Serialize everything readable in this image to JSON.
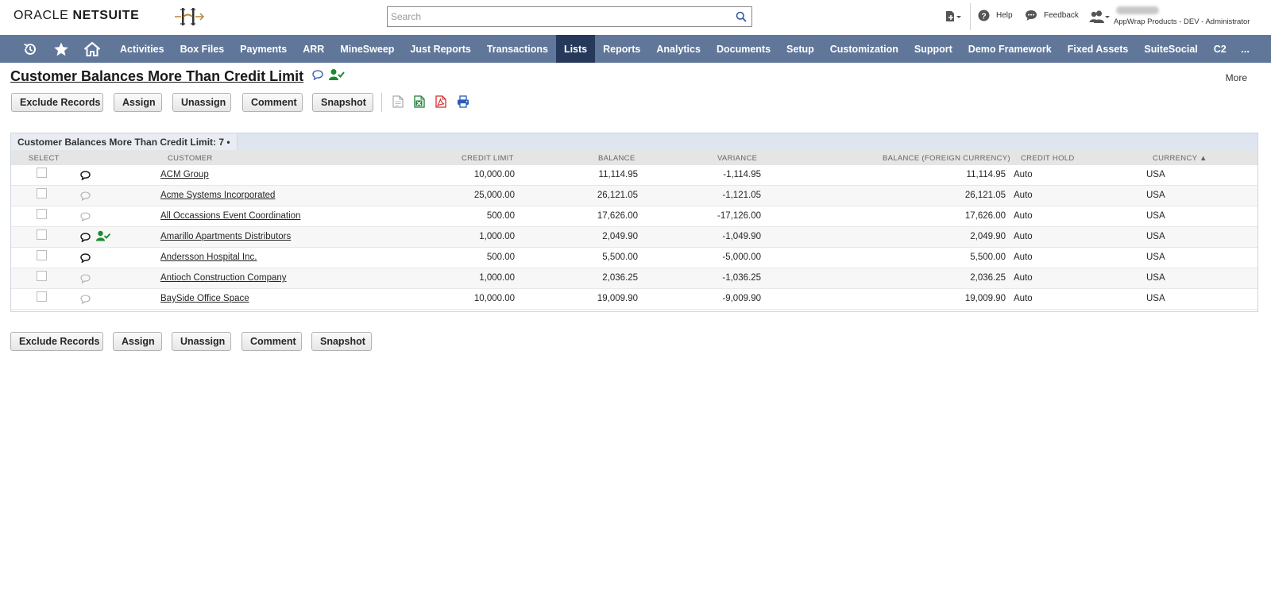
{
  "header": {
    "brand_oracle": "ORACLE",
    "brand_netsuite": "NETSUITE",
    "search_placeholder": "Search",
    "help_label": "Help",
    "feedback_label": "Feedback",
    "user_role": "AppWrap Products - DEV - Administrator"
  },
  "nav": {
    "items": [
      "Activities",
      "Box Files",
      "Payments",
      "ARR",
      "MineSweep",
      "Just Reports",
      "Transactions",
      "Lists",
      "Reports",
      "Analytics",
      "Documents",
      "Setup",
      "Customization",
      "Support",
      "Demo Framework",
      "Fixed Assets",
      "SuiteSocial",
      "C2"
    ],
    "active": "Lists",
    "more": "..."
  },
  "page": {
    "title": "Customer Balances More Than Credit Limit",
    "more_label": "More"
  },
  "toolbar": {
    "exclude": "Exclude Records",
    "assign": "Assign",
    "unassign": "Unassign",
    "comment": "Comment",
    "snapshot": "Snapshot"
  },
  "list": {
    "title": "Customer Balances More Than Credit Limit: 7 •",
    "columns": {
      "select": "SELECT",
      "customer": "CUSTOMER",
      "credit_limit": "CREDIT LIMIT",
      "balance": "BALANCE",
      "variance": "VARIANCE",
      "balance_fc": "BALANCE (FOREIGN CURRENCY)",
      "credit_hold": "CREDIT HOLD",
      "currency": "CURRENCY ▲"
    },
    "rows": [
      {
        "customer": "ACM Group",
        "credit_limit": "10,000.00",
        "balance": "11,114.95",
        "variance": "-1,114.95",
        "balance_fc": "11,114.95",
        "credit_hold": "Auto",
        "currency": "USA",
        "comment": "dark",
        "assigned": false
      },
      {
        "customer": "Acme Systems Incorporated",
        "credit_limit": "25,000.00",
        "balance": "26,121.05",
        "variance": "-1,121.05",
        "balance_fc": "26,121.05",
        "credit_hold": "Auto",
        "currency": "USA",
        "comment": "light",
        "assigned": false
      },
      {
        "customer": "All Occassions Event Coordination",
        "credit_limit": "500.00",
        "balance": "17,626.00",
        "variance": "-17,126.00",
        "balance_fc": "17,626.00",
        "credit_hold": "Auto",
        "currency": "USA",
        "comment": "light",
        "assigned": false
      },
      {
        "customer": "Amarillo Apartments Distributors",
        "credit_limit": "1,000.00",
        "balance": "2,049.90",
        "variance": "-1,049.90",
        "balance_fc": "2,049.90",
        "credit_hold": "Auto",
        "currency": "USA",
        "comment": "dark",
        "assigned": true
      },
      {
        "customer": "Andersson Hospital Inc.",
        "credit_limit": "500.00",
        "balance": "5,500.00",
        "variance": "-5,000.00",
        "balance_fc": "5,500.00",
        "credit_hold": "Auto",
        "currency": "USA",
        "comment": "dark",
        "assigned": false
      },
      {
        "customer": "Antioch Construction Company",
        "credit_limit": "1,000.00",
        "balance": "2,036.25",
        "variance": "-1,036.25",
        "balance_fc": "2,036.25",
        "credit_hold": "Auto",
        "currency": "USA",
        "comment": "light",
        "assigned": false
      },
      {
        "customer": "BaySide Office Space",
        "credit_limit": "10,000.00",
        "balance": "19,009.90",
        "variance": "-9,009.90",
        "balance_fc": "19,009.90",
        "credit_hold": "Auto",
        "currency": "USA",
        "comment": "light",
        "assigned": false
      }
    ]
  },
  "icons": {
    "nav": [
      "recent-records-icon",
      "star-icon",
      "home-icon"
    ],
    "export": [
      "csv-icon",
      "excel-icon",
      "pdf-icon",
      "print-icon"
    ]
  },
  "colors": {
    "nav_bg": "#607799",
    "nav_active": "#26395b",
    "assign_green": "#1a8a2e",
    "excel_green": "#1e7e34",
    "pdf_red": "#d32f2f",
    "print_blue": "#2a5bb5"
  }
}
